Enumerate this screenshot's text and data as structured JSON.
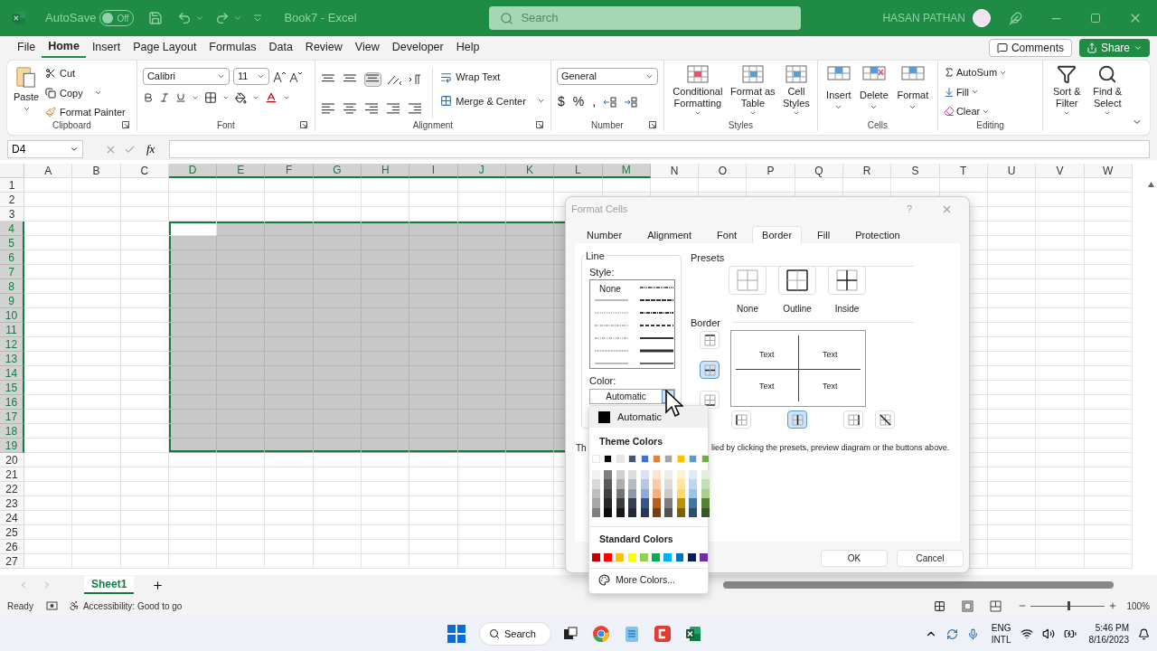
{
  "title_bar": {
    "autosave_label": "AutoSave",
    "autosave": {
      "label": "Off",
      "on": false
    },
    "document_title": "Book7 - Excel",
    "search": {
      "placeholder": "Search"
    },
    "user_name": "HASAN PATHAN"
  },
  "menu_tabs": [
    {
      "label": "File",
      "selected": false
    },
    {
      "label": "Home",
      "selected": true
    },
    {
      "label": "Insert",
      "selected": false
    },
    {
      "label": "Page Layout",
      "selected": false
    },
    {
      "label": "Formulas",
      "selected": false
    },
    {
      "label": "Data",
      "selected": false
    },
    {
      "label": "Review",
      "selected": false
    },
    {
      "label": "View",
      "selected": false
    },
    {
      "label": "Developer",
      "selected": false
    },
    {
      "label": "Help",
      "selected": false
    }
  ],
  "comments_button": "Comments",
  "share_button": "Share",
  "ribbon": {
    "clipboard": {
      "label": "Clipboard",
      "paste": "Paste",
      "cut": "Cut",
      "copy": "Copy",
      "format_painter": "Format Painter"
    },
    "font": {
      "label": "Font",
      "font_name": "Calibri",
      "font_size": "11"
    },
    "alignment": {
      "label": "Alignment",
      "wrap_text": "Wrap Text",
      "merge_center": "Merge & Center"
    },
    "number": {
      "label": "Number",
      "format": "General",
      "symbols": [
        "$",
        "%",
        ","
      ]
    },
    "styles": {
      "label": "Styles",
      "buttons": [
        "Conditional Formatting",
        "Format as Table",
        "Cell Styles"
      ]
    },
    "cells": {
      "label": "Cells",
      "buttons": [
        "Insert",
        "Delete",
        "Format"
      ]
    },
    "editing": {
      "label": "Editing",
      "autosum": "AutoSum",
      "fill": "Fill",
      "clear": "Clear",
      "sort_filter": "Sort & Filter",
      "find_select": "Find & Select"
    }
  },
  "formula_bar": {
    "name_box": "D4",
    "function_label": "fx"
  },
  "columns": [
    {
      "label": "A",
      "selected": false
    },
    {
      "label": "B",
      "selected": false
    },
    {
      "label": "C",
      "selected": false
    },
    {
      "label": "D",
      "selected": true
    },
    {
      "label": "E",
      "selected": true
    },
    {
      "label": "F",
      "selected": true
    },
    {
      "label": "G",
      "selected": true
    },
    {
      "label": "H",
      "selected": true
    },
    {
      "label": "I",
      "selected": true
    },
    {
      "label": "J",
      "selected": true
    },
    {
      "label": "K",
      "selected": true
    },
    {
      "label": "L",
      "selected": true
    },
    {
      "label": "M",
      "selected": true
    },
    {
      "label": "N",
      "selected": false
    },
    {
      "label": "O",
      "selected": false
    },
    {
      "label": "P",
      "selected": false
    },
    {
      "label": "Q",
      "selected": false
    },
    {
      "label": "R",
      "selected": false
    },
    {
      "label": "S",
      "selected": false
    },
    {
      "label": "T",
      "selected": false
    },
    {
      "label": "U",
      "selected": false
    },
    {
      "label": "V",
      "selected": false
    },
    {
      "label": "W",
      "selected": false
    }
  ],
  "rows": [
    {
      "label": "1",
      "selected": false
    },
    {
      "label": "2",
      "selected": false
    },
    {
      "label": "3",
      "selected": false
    },
    {
      "label": "4",
      "selected": true
    },
    {
      "label": "5",
      "selected": true
    },
    {
      "label": "6",
      "selected": true
    },
    {
      "label": "7",
      "selected": true
    },
    {
      "label": "8",
      "selected": true
    },
    {
      "label": "9",
      "selected": true
    },
    {
      "label": "10",
      "selected": true
    },
    {
      "label": "11",
      "selected": true
    },
    {
      "label": "12",
      "selected": true
    },
    {
      "label": "13",
      "selected": true
    },
    {
      "label": "14",
      "selected": true
    },
    {
      "label": "15",
      "selected": true
    },
    {
      "label": "16",
      "selected": true
    },
    {
      "label": "17",
      "selected": true
    },
    {
      "label": "18",
      "selected": true
    },
    {
      "label": "19",
      "selected": true
    },
    {
      "label": "20",
      "selected": false
    },
    {
      "label": "21",
      "selected": false
    },
    {
      "label": "22",
      "selected": false
    },
    {
      "label": "23",
      "selected": false
    },
    {
      "label": "24",
      "selected": false
    },
    {
      "label": "25",
      "selected": false
    },
    {
      "label": "26",
      "selected": false
    },
    {
      "label": "27",
      "selected": false
    }
  ],
  "dialog": {
    "title": "Format Cells",
    "help": "?",
    "tabs": [
      {
        "label": "Number",
        "selected": false
      },
      {
        "label": "Alignment",
        "selected": false
      },
      {
        "label": "Font",
        "selected": false
      },
      {
        "label": "Border",
        "selected": true
      },
      {
        "label": "Fill",
        "selected": false
      },
      {
        "label": "Protection",
        "selected": false
      }
    ],
    "line_heading": "Line",
    "style_label": "Style:",
    "style_none": "None",
    "color_label": "Color:",
    "color_value": "Automatic",
    "presets_heading": "Presets",
    "presets": [
      {
        "label": "None",
        "kind": "none"
      },
      {
        "label": "Outline",
        "kind": "outline"
      },
      {
        "label": "Inside",
        "kind": "inside"
      }
    ],
    "border_heading": "Border",
    "preview_texts": [
      "Text",
      "Text",
      "Text",
      "Text"
    ],
    "side_buttons": [
      {
        "kind": "top",
        "selected": false
      },
      {
        "kind": "middle",
        "selected": true
      },
      {
        "kind": "bottom",
        "selected": false
      }
    ],
    "bottom_buttons": [
      {
        "kind": "left",
        "selected": false
      },
      {
        "kind": "center",
        "selected": true
      },
      {
        "kind": "right",
        "selected": false
      },
      {
        "kind": "diagonal",
        "selected": false
      }
    ],
    "note_start": "Th",
    "note_end": "lied by clicking the presets, preview diagram or the buttons above.",
    "buttons": [
      "OK",
      "Cancel"
    ]
  },
  "color_menu": {
    "automatic": "Automatic",
    "theme_heading": "Theme Colors",
    "theme_colors": [
      {
        "color": "#ffffff"
      },
      {
        "color": "#000000"
      },
      {
        "color": "#e7e6e6"
      },
      {
        "color": "#44546a"
      },
      {
        "color": "#4472c4"
      },
      {
        "color": "#ed7d31"
      },
      {
        "color": "#a5a5a5"
      },
      {
        "color": "#ffc000"
      },
      {
        "color": "#5b9bd5"
      },
      {
        "color": "#70ad47"
      }
    ],
    "standard_heading": "Standard Colors",
    "standard_colors": [
      {
        "color": "#c00000"
      },
      {
        "color": "#ff0000"
      },
      {
        "color": "#ffc000"
      },
      {
        "color": "#ffff00"
      },
      {
        "color": "#92d050"
      },
      {
        "color": "#00b050"
      },
      {
        "color": "#00b0f0"
      },
      {
        "color": "#0070c0"
      },
      {
        "color": "#002060"
      },
      {
        "color": "#7030a0"
      }
    ],
    "more_colors": "More Colors..."
  },
  "sheet_tabs": [
    {
      "label": "Sheet1",
      "selected": true
    }
  ],
  "status_bar": {
    "ready": "Ready",
    "accessibility": "Accessibility: Good to go",
    "zoom": {
      "level": 0.49
    },
    "zoom_label": "100%"
  },
  "taskbar": {
    "search": "Search",
    "language": "ENG",
    "layout": "INTL",
    "time": "5:46 PM",
    "date": "8/16/2023"
  }
}
